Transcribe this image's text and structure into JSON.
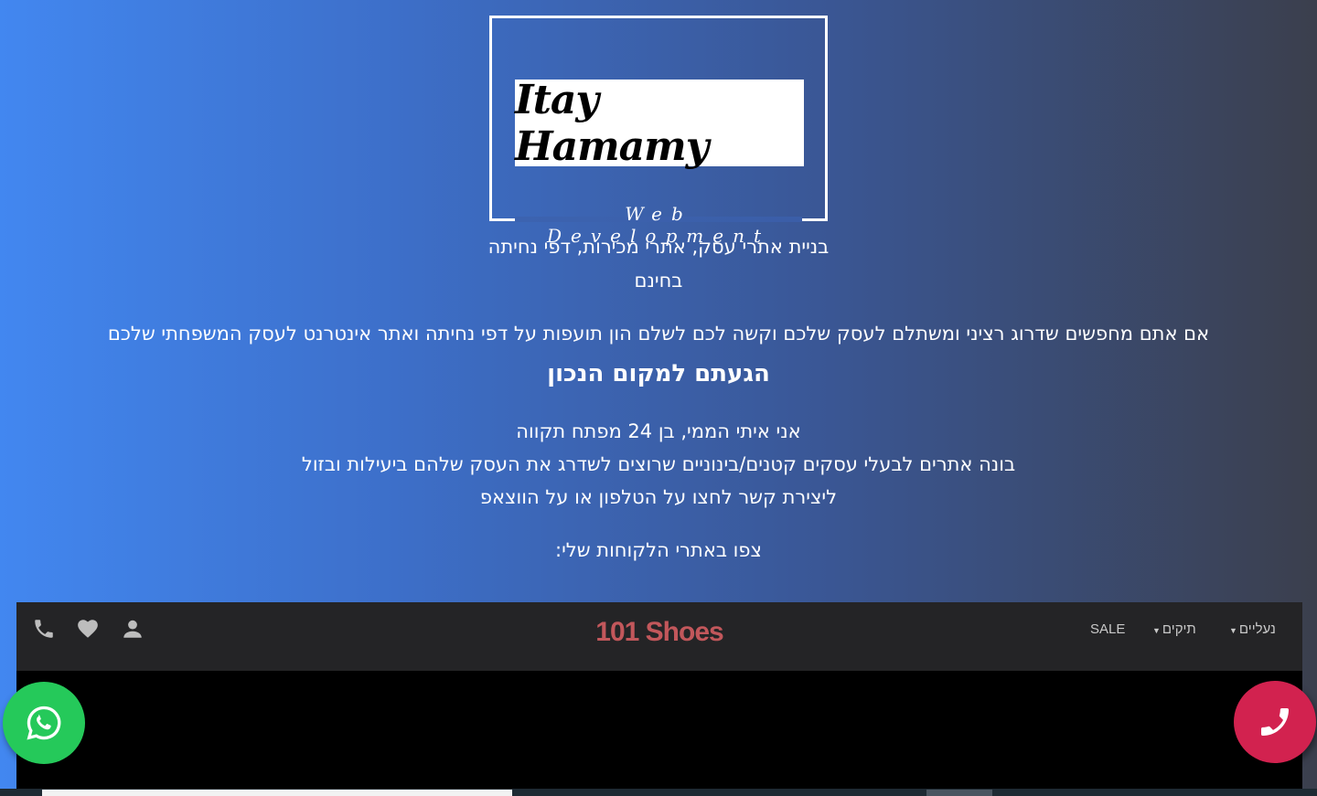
{
  "logo": {
    "name": "Itay Hamamy",
    "tagline": "Web Development"
  },
  "intro": {
    "line1": "בניית אתרי עסק, אתרי מכירות, דפי נחיתה",
    "line2": "בחינם",
    "line3": "אם אתם מחפשים שדרוג רציני ומשתלם לעסק שלכם וקשה לכם לשלם הון תועפות על דפי נחיתה ואתר אינטרנט לעסק המשפחתי שלכם",
    "headline": "הגעתם למקום הנכון"
  },
  "about": {
    "line1": "אני איתי הממי, בן 24 מפתח תקווה",
    "line2": "בונה אתרים לבעלי עסקים קטנים/בינוניים שרוצים לשדרג את העסק שלהם ביעילות ובזול",
    "line3": "ליצירת קשר לחצו על הטלפון או על הווצאפ"
  },
  "clients_heading": "צפו באתרי הלקוחות שלי:",
  "preview_site": {
    "title": "101 Shoes",
    "nav": [
      "נעליים",
      "תיקים",
      "SALE"
    ],
    "icons": [
      "phone-icon",
      "heart-icon",
      "user-icon"
    ],
    "title_color": "#c2575b"
  },
  "floating_buttons": {
    "whatsapp": {
      "icon": "whatsapp-icon",
      "color": "#25c95a"
    },
    "call": {
      "icon": "phone-icon",
      "color": "#d2224f"
    }
  }
}
